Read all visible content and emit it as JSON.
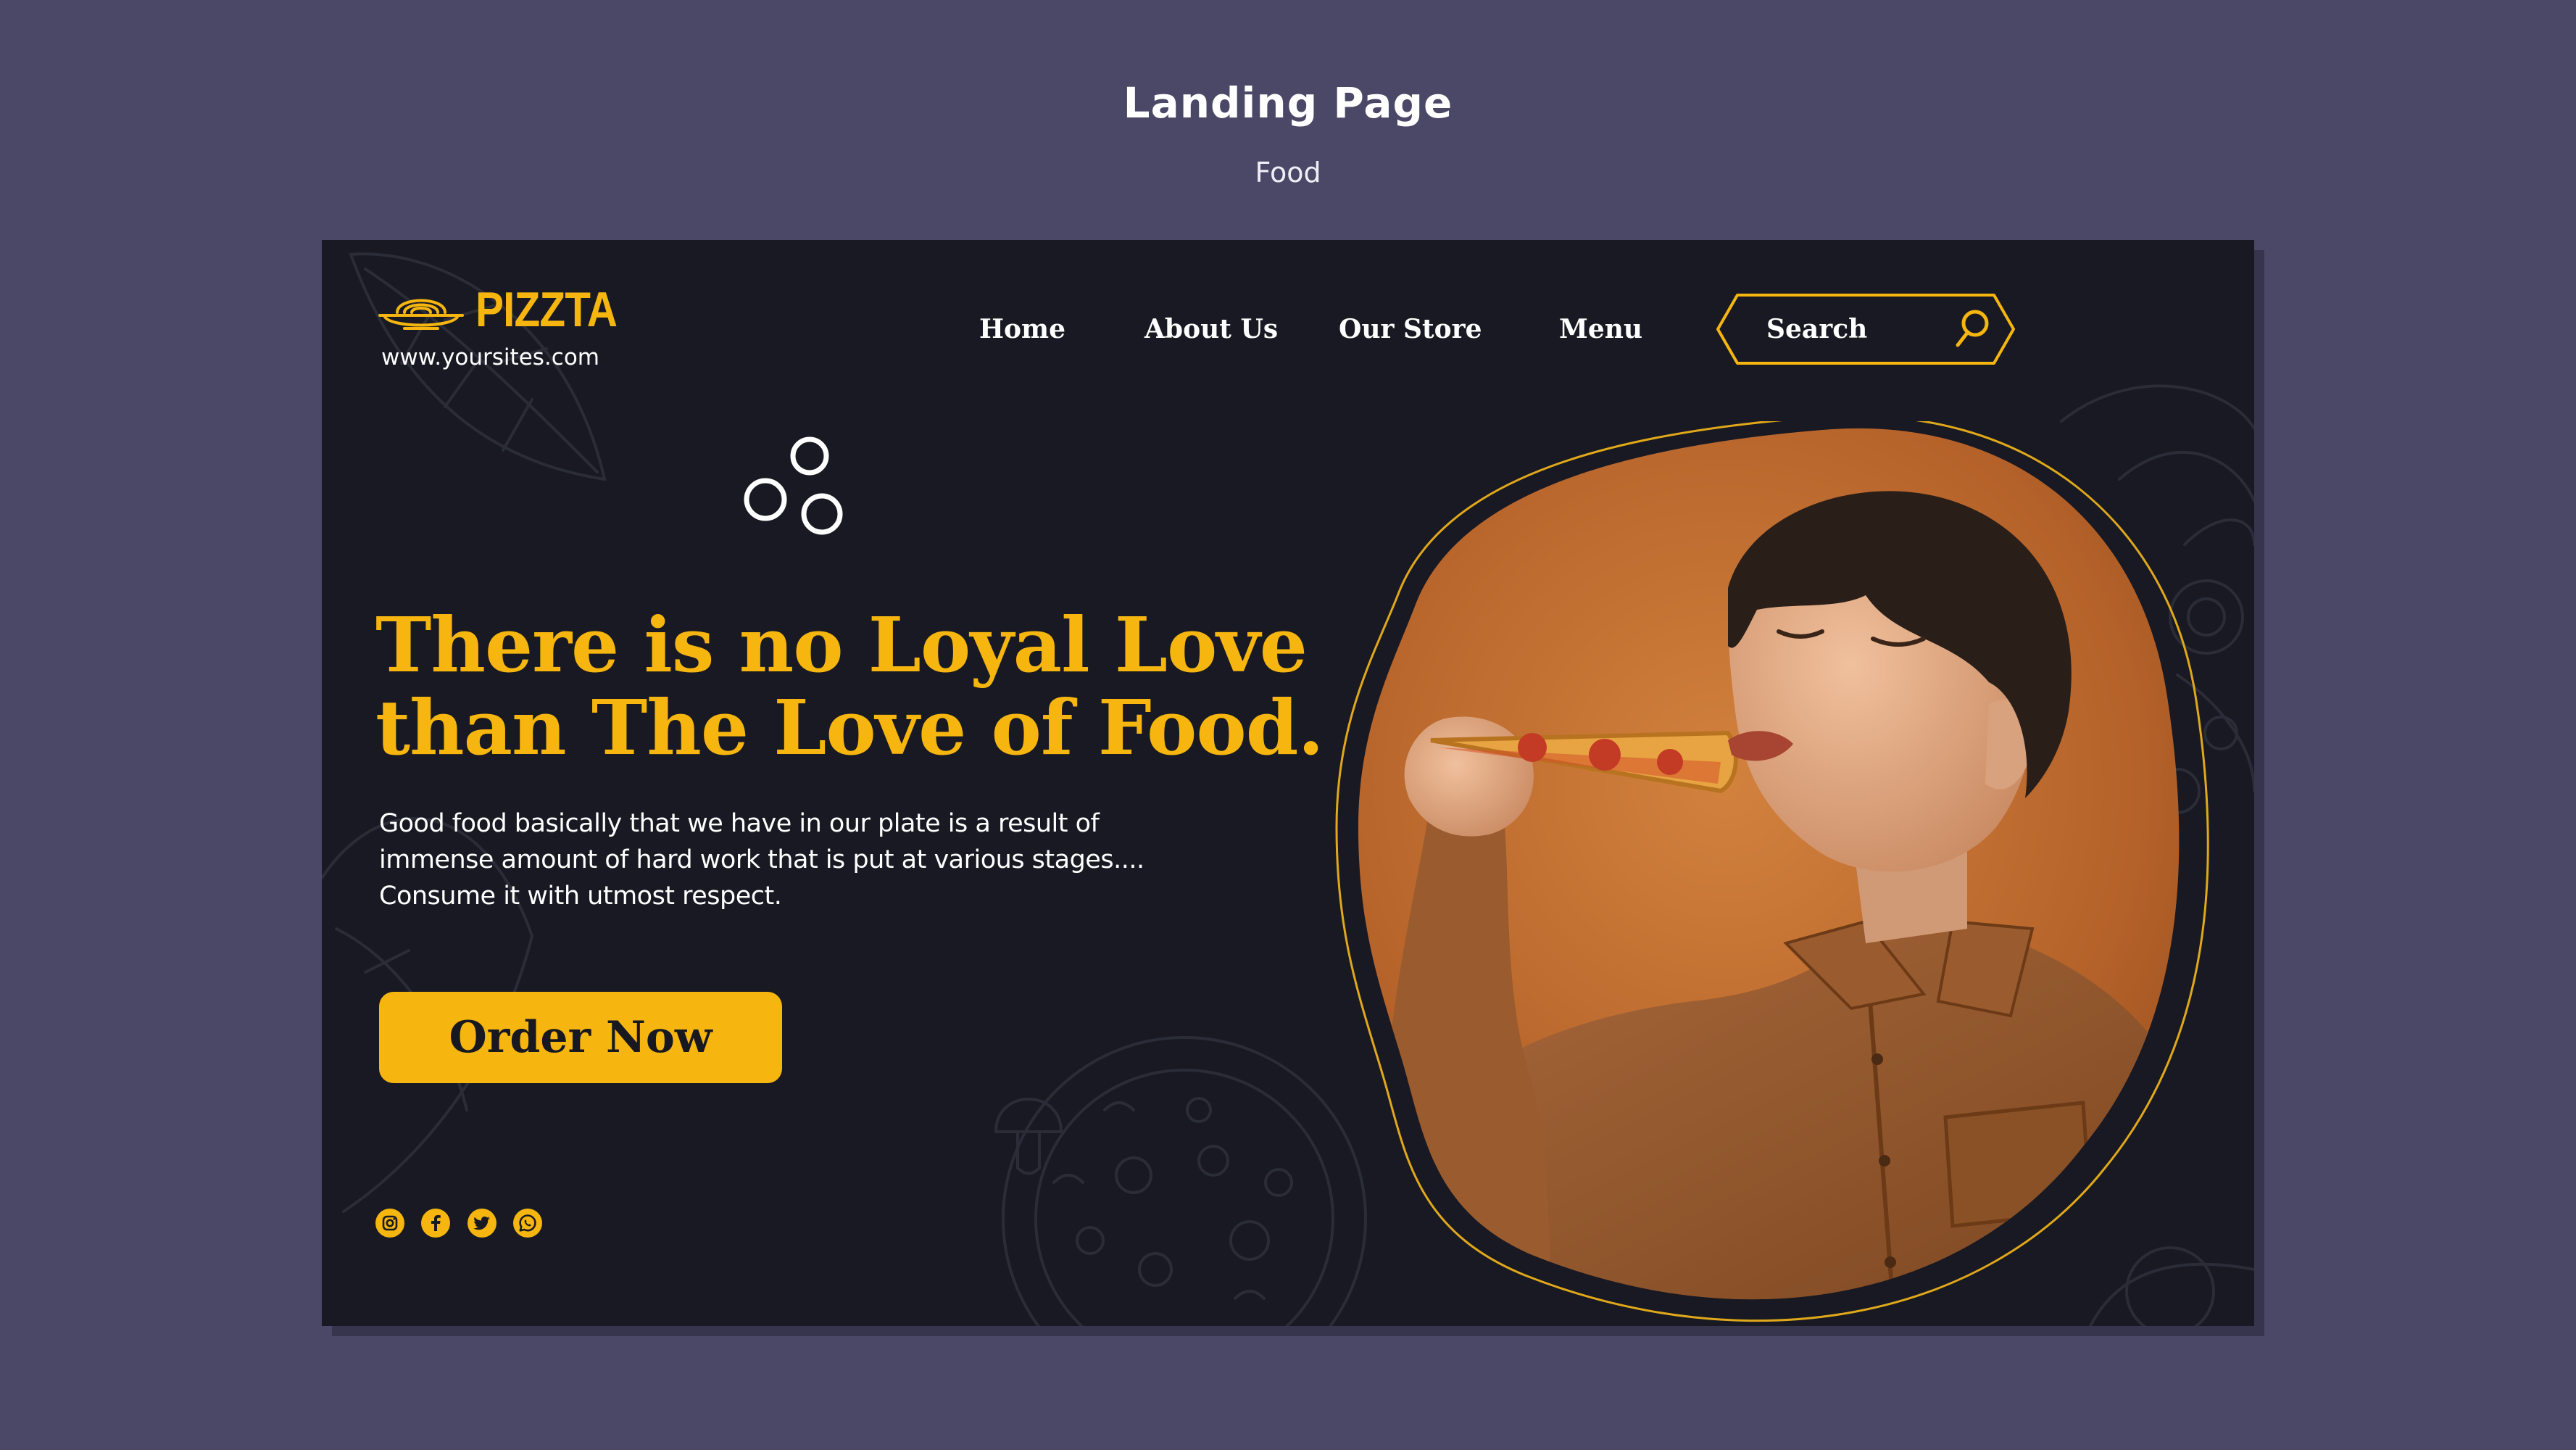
{
  "page": {
    "title": "Landing Page",
    "subtitle": "Food"
  },
  "brand": {
    "name": "PIZZTA",
    "url": "www.yoursites.com",
    "accent_color": "#f6b60f",
    "background_color": "#181922",
    "frame_color": "#4b4766"
  },
  "nav": {
    "items": [
      {
        "label": "Home"
      },
      {
        "label": "About Us"
      },
      {
        "label": "Our Store"
      },
      {
        "label": "Menu"
      }
    ]
  },
  "search": {
    "placeholder": "Search",
    "icon": "search-icon"
  },
  "hero": {
    "headline_line_1": "There is no Loyal Love",
    "headline_line_2": "than The Love of Food.",
    "body": "Good food basically that we have in our plate is a result of immense amount of hard work that is put at various stages.... Consume it with utmost respect.",
    "cta_label": "Order Now",
    "image": "boy-eating-pizza-photo"
  },
  "socials": [
    {
      "icon": "instagram-icon"
    },
    {
      "icon": "facebook-icon"
    },
    {
      "icon": "twitter-icon"
    },
    {
      "icon": "whatsapp-icon"
    }
  ]
}
